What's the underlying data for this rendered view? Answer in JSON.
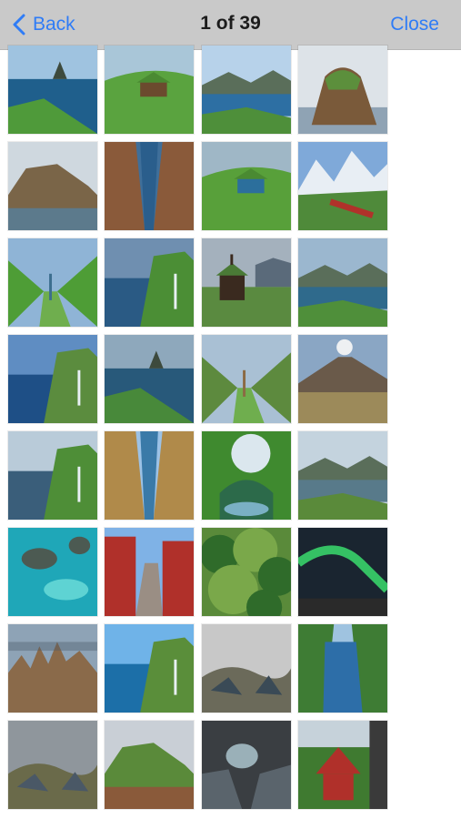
{
  "navbar": {
    "back_label": "Back",
    "title": "1 of 39",
    "close_label": "Close",
    "accent_color": "#2f7cf6",
    "background_color": "#c9c9c9"
  },
  "gallery": {
    "total_photos": 39,
    "visible_rows": 8,
    "columns": 4,
    "thumbnails": [
      {
        "name": "photo-sea-stack-coast",
        "sky": "#9fc3e0",
        "land": "#4f9a3a",
        "accent": "#1f5f8c",
        "shape": "stack"
      },
      {
        "name": "photo-turf-roof-village",
        "sky": "#a9c6d8",
        "land": "#5aa33f",
        "accent": "#6b4a2e",
        "shape": "meadow"
      },
      {
        "name": "photo-fjord-islands",
        "sky": "#b7d2ea",
        "land": "#4e8f3a",
        "accent": "#2d6fa3",
        "shape": "fjord"
      },
      {
        "name": "photo-green-cliff-island",
        "sky": "#dde3e8",
        "land": "#5c8f3c",
        "accent": "#7a5a3a",
        "shape": "island"
      },
      {
        "name": "photo-rocky-headland",
        "sky": "#cfd8df",
        "land": "#7a6548",
        "accent": "#5c7a8c",
        "shape": "headland"
      },
      {
        "name": "photo-canyon-river",
        "sky": "#3f6f9a",
        "land": "#8a5a3a",
        "accent": "#2a5e8c",
        "shape": "canyon"
      },
      {
        "name": "photo-turf-houses-bay",
        "sky": "#9fb7c6",
        "land": "#58a03a",
        "accent": "#2c6f9c",
        "shape": "meadow"
      },
      {
        "name": "photo-alpine-train",
        "sky": "#7fa9d9",
        "land": "#4f8a3a",
        "accent": "#b0322a",
        "shape": "alps"
      },
      {
        "name": "photo-valley-village",
        "sky": "#8fb4d6",
        "land": "#4e9d36",
        "accent": "#3c6e8e",
        "shape": "valley"
      },
      {
        "name": "photo-cliff-lighthouse",
        "sky": "#6f8fb0",
        "land": "#4b8e35",
        "accent": "#2a5a84",
        "shape": "cliffs"
      },
      {
        "name": "photo-black-church",
        "sky": "#a4b1bd",
        "land": "#5a8a40",
        "accent": "#3a2a1f",
        "shape": "church"
      },
      {
        "name": "photo-mountain-fjord",
        "sky": "#9bb7cf",
        "land": "#4f8f3a",
        "accent": "#2f6a8c",
        "shape": "fjord"
      },
      {
        "name": "photo-coastal-cliffs-sea",
        "sky": "#5f8dc2",
        "land": "#5b8c3e",
        "accent": "#1e4f86",
        "shape": "cliffs"
      },
      {
        "name": "photo-trollanes-cliff",
        "sky": "#8ea8bc",
        "land": "#48893a",
        "accent": "#28597a",
        "shape": "stack"
      },
      {
        "name": "photo-waterfall-valley",
        "sky": "#a9c0d4",
        "land": "#5d8a3e",
        "accent": "#8b6a44",
        "shape": "valley"
      },
      {
        "name": "photo-volcano-llamas",
        "sky": "#8aa6c4",
        "land": "#9c8a5a",
        "accent": "#6a5a4a",
        "shape": "volcano"
      },
      {
        "name": "photo-waterfall-cliff",
        "sky": "#b9cbd9",
        "land": "#4e8e37",
        "accent": "#3a5e7a",
        "shape": "cliffs"
      },
      {
        "name": "photo-canyon-lake",
        "sky": "#9cc2e6",
        "land": "#b08a4a",
        "accent": "#3a7aa8",
        "shape": "canyon"
      },
      {
        "name": "photo-green-arch-pool",
        "sky": "#dbe7ee",
        "land": "#3f8a2f",
        "accent": "#2c6a4a",
        "shape": "arch"
      },
      {
        "name": "photo-fjord-viewpoint",
        "sky": "#c4d3de",
        "land": "#5a8a3a",
        "accent": "#587a8a",
        "shape": "fjord"
      },
      {
        "name": "photo-turquoise-lagoon",
        "sky": "#1fa7b8",
        "land": "#4c5a52",
        "accent": "#5ed3d3",
        "shape": "lagoon"
      },
      {
        "name": "photo-red-house-street",
        "sky": "#7fb2e6",
        "land": "#9a8e84",
        "accent": "#b0302a",
        "shape": "street"
      },
      {
        "name": "photo-forest-canopy",
        "sky": "#5a8a3a",
        "land": "#2f6b2a",
        "accent": "#7aa84a",
        "shape": "forest"
      },
      {
        "name": "photo-aurora-night",
        "sky": "#1a2530",
        "land": "#2a2a2a",
        "accent": "#39d36a",
        "shape": "aurora"
      },
      {
        "name": "photo-rock-pinnacles",
        "sky": "#8ea3b6",
        "land": "#8a6a4a",
        "accent": "#4a5a6a",
        "shape": "pinnacles"
      },
      {
        "name": "photo-waterfall-sea",
        "sky": "#6fb3e8",
        "land": "#5a8e3a",
        "accent": "#1c6fa8",
        "shape": "cliffs"
      },
      {
        "name": "photo-sea-cliff-rocks",
        "sky": "#c8c8c8",
        "land": "#6b6a5a",
        "accent": "#3a4a56",
        "shape": "rocks"
      },
      {
        "name": "photo-lake-town",
        "sky": "#9fc3e0",
        "land": "#3e7c34",
        "accent": "#2d6ea8",
        "shape": "lake"
      },
      {
        "name": "photo-stormy-coast",
        "sky": "#8f969c",
        "land": "#6a6a4a",
        "accent": "#4a5866",
        "shape": "rocks"
      },
      {
        "name": "photo-green-peninsula",
        "sky": "#c9cfd6",
        "land": "#5a8a3a",
        "accent": "#8a5a3a",
        "shape": "headland"
      },
      {
        "name": "photo-sea-cave",
        "sky": "#5a646c",
        "land": "#3a3e42",
        "accent": "#9ab0b8",
        "shape": "cave"
      },
      {
        "name": "photo-red-cabin",
        "sky": "#c6d2da",
        "land": "#3f7a30",
        "accent": "#b0302a",
        "shape": "cabin"
      }
    ]
  }
}
